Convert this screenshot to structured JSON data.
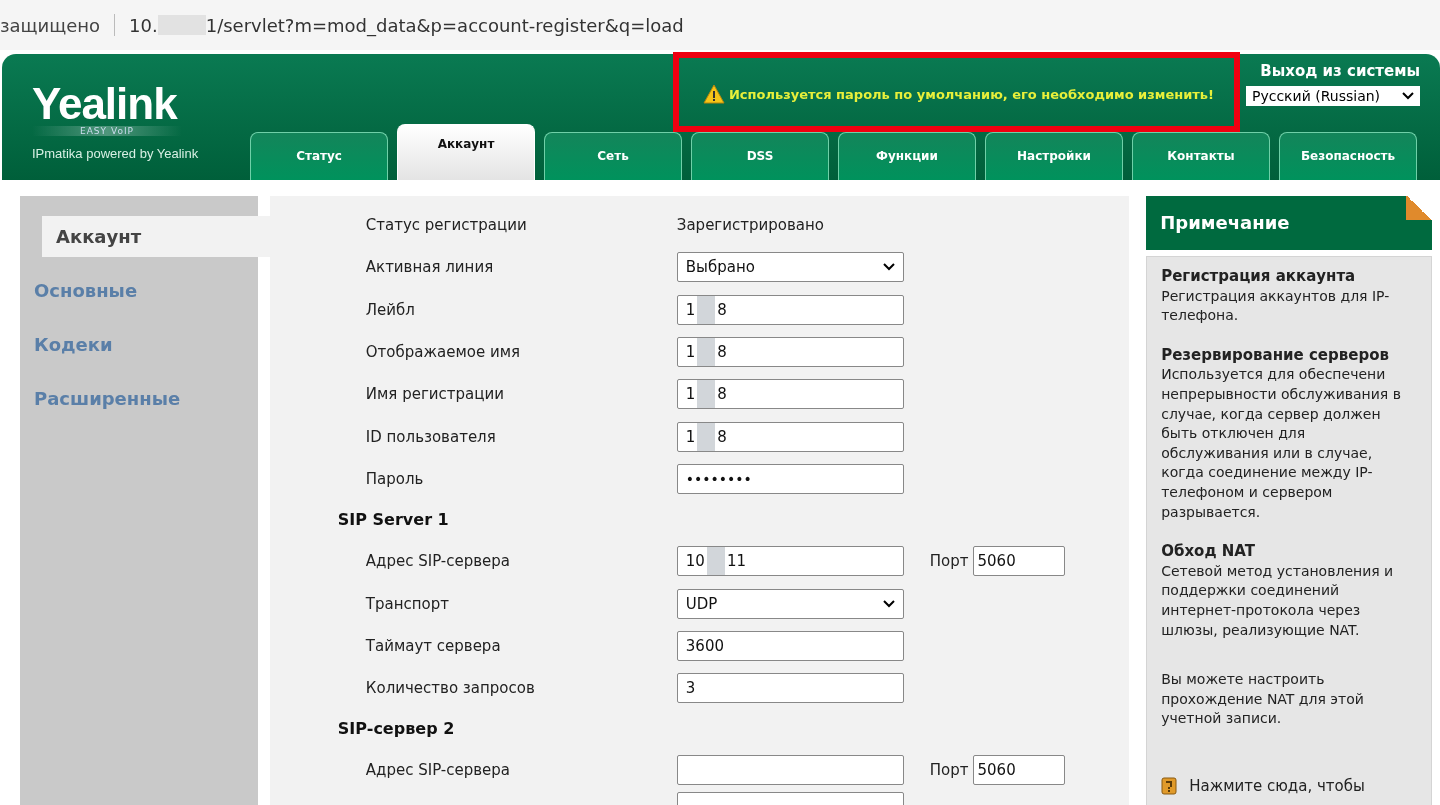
{
  "address_bar": {
    "security": "защищено",
    "url_parts": [
      "10.",
      "1/servlet?m=mod_data&p=account-register&q=load"
    ]
  },
  "header": {
    "logo": "Yealink",
    "logo_tagline": "EASY VoIP",
    "subtitle": "IPmatika powered by Yealink",
    "logout": "Выход из системы",
    "warning": "Используется пароль по умолчанию, его необходимо изменить!",
    "warning_highlighted": true,
    "language": "Русский (Russian)"
  },
  "tabs": [
    {
      "label": "Статус",
      "selected": false
    },
    {
      "label": "Аккаунт",
      "selected": true
    },
    {
      "label": "Сеть",
      "selected": false
    },
    {
      "label": "DSS",
      "selected": false
    },
    {
      "label": "Функции",
      "selected": false
    },
    {
      "label": "Настройки",
      "selected": false
    },
    {
      "label": "Контакты",
      "selected": false
    },
    {
      "label": "Безопасность",
      "selected": false
    }
  ],
  "sidebar": {
    "items": [
      {
        "label": "Аккаунт",
        "selected": true
      },
      {
        "label": "Основные",
        "selected": false
      },
      {
        "label": "Кодеки",
        "selected": false
      },
      {
        "label": "Расширенные",
        "selected": false
      }
    ]
  },
  "form": [
    {
      "kind": "text",
      "label": "Статус регистрации",
      "value": "Зарегистрировано"
    },
    {
      "kind": "select",
      "label": "Активная линия",
      "value": "Выбрано"
    },
    {
      "kind": "input",
      "label": "Лейбл",
      "value_parts": [
        "1",
        "8"
      ]
    },
    {
      "kind": "input",
      "label": "Отображаемое имя",
      "value_parts": [
        "1",
        "8"
      ]
    },
    {
      "kind": "input",
      "label": "Имя регистрации",
      "value_parts": [
        "1",
        "8"
      ]
    },
    {
      "kind": "input",
      "label": "ID пользователя",
      "value_parts": [
        "1",
        "8"
      ]
    },
    {
      "kind": "password",
      "label": "Пароль",
      "value": "••••••••"
    },
    {
      "kind": "heading",
      "label": "SIP Server 1"
    },
    {
      "kind": "input",
      "label": "Адрес SIP-сервера",
      "value_parts": [
        "10",
        "11"
      ],
      "port_label": "Порт",
      "port": "5060"
    },
    {
      "kind": "select",
      "label": "Транспорт",
      "value": "UDP"
    },
    {
      "kind": "input",
      "label": "Таймаут сервера",
      "value_parts": [
        "3600"
      ]
    },
    {
      "kind": "input",
      "label": "Количество запросов",
      "value_parts": [
        "3"
      ]
    },
    {
      "kind": "heading",
      "label": "SIP-сервер 2"
    },
    {
      "kind": "input",
      "label": "Адрес SIP-сервера",
      "port_label": "Порт",
      "port": "5060"
    },
    {
      "kind": "stub"
    }
  ],
  "notes": {
    "title": "Примечание",
    "sections": [
      {
        "heading": "Регистрация аккаунта",
        "lines": [
          "Регистрация аккаунтов для IP-",
          "телефона."
        ]
      },
      {
        "heading": "Резервирование серверов",
        "lines": [
          "Используется для обеспечени",
          "непрерывности обслуживания в",
          "случае, когда сервер должен",
          "быть отключен для",
          "обслуживания или в случае,",
          "когда соединение между IP-",
          "телефоном и сервером",
          "разрывается."
        ]
      },
      {
        "heading": "Обход NAT",
        "lines": [
          "Сетевой метод установления и",
          "поддержки соединений",
          "интернет-протокола через",
          "шлюзы, реализующие NAT."
        ]
      },
      {
        "lines": [
          "Вы можете настроить",
          "прохождение NAT для этой",
          "учетной записи."
        ]
      }
    ],
    "help_link": "Нажмите сюда, чтобы"
  }
}
